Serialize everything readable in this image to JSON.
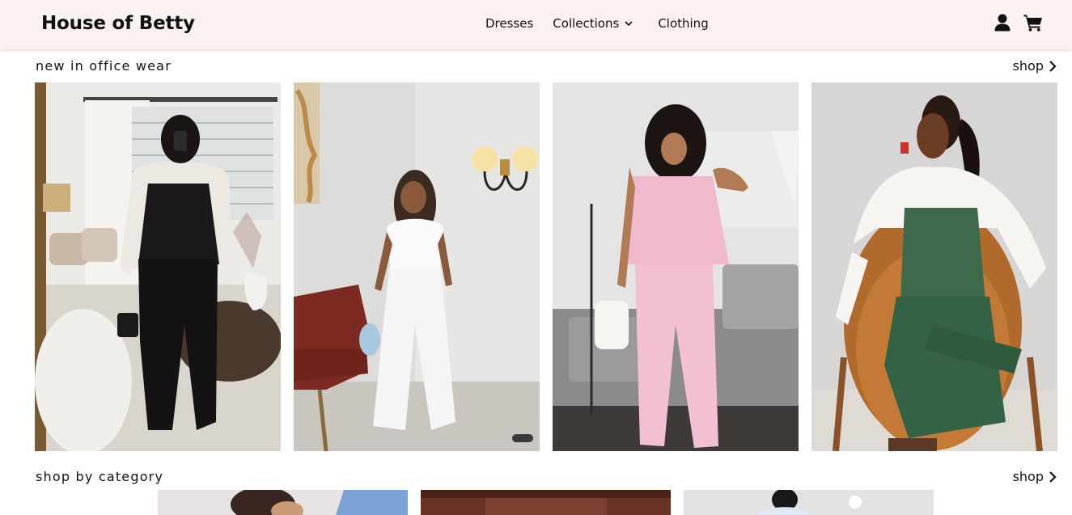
{
  "brand": {
    "name": "House of Betty"
  },
  "nav": {
    "dresses": "Dresses",
    "collections": "Collections",
    "clothing": "Clothing"
  },
  "icons": {
    "user": "user-icon",
    "cart": "cart-icon",
    "chevron": "chevron-down-icon",
    "arrow": "chevron-right-icon"
  },
  "colors": {
    "navbar_bg": "#fbf1f0",
    "text": "#111111"
  },
  "sections": {
    "new_in": {
      "title": "new in office wear",
      "link": "shop",
      "products": [
        {
          "image": "black vest and wide-leg trousers outfit"
        },
        {
          "image": "white halter top and wide-leg trousers outfit"
        },
        {
          "image": "pink strapless top and trousers set"
        },
        {
          "image": "green denim jumpsuit with white shirt"
        }
      ]
    },
    "by_category": {
      "title": "shop by category",
      "link": "shop",
      "categories": [
        {
          "image": "category tile 1"
        },
        {
          "image": "category tile 2"
        },
        {
          "image": "category tile 3"
        }
      ]
    }
  }
}
